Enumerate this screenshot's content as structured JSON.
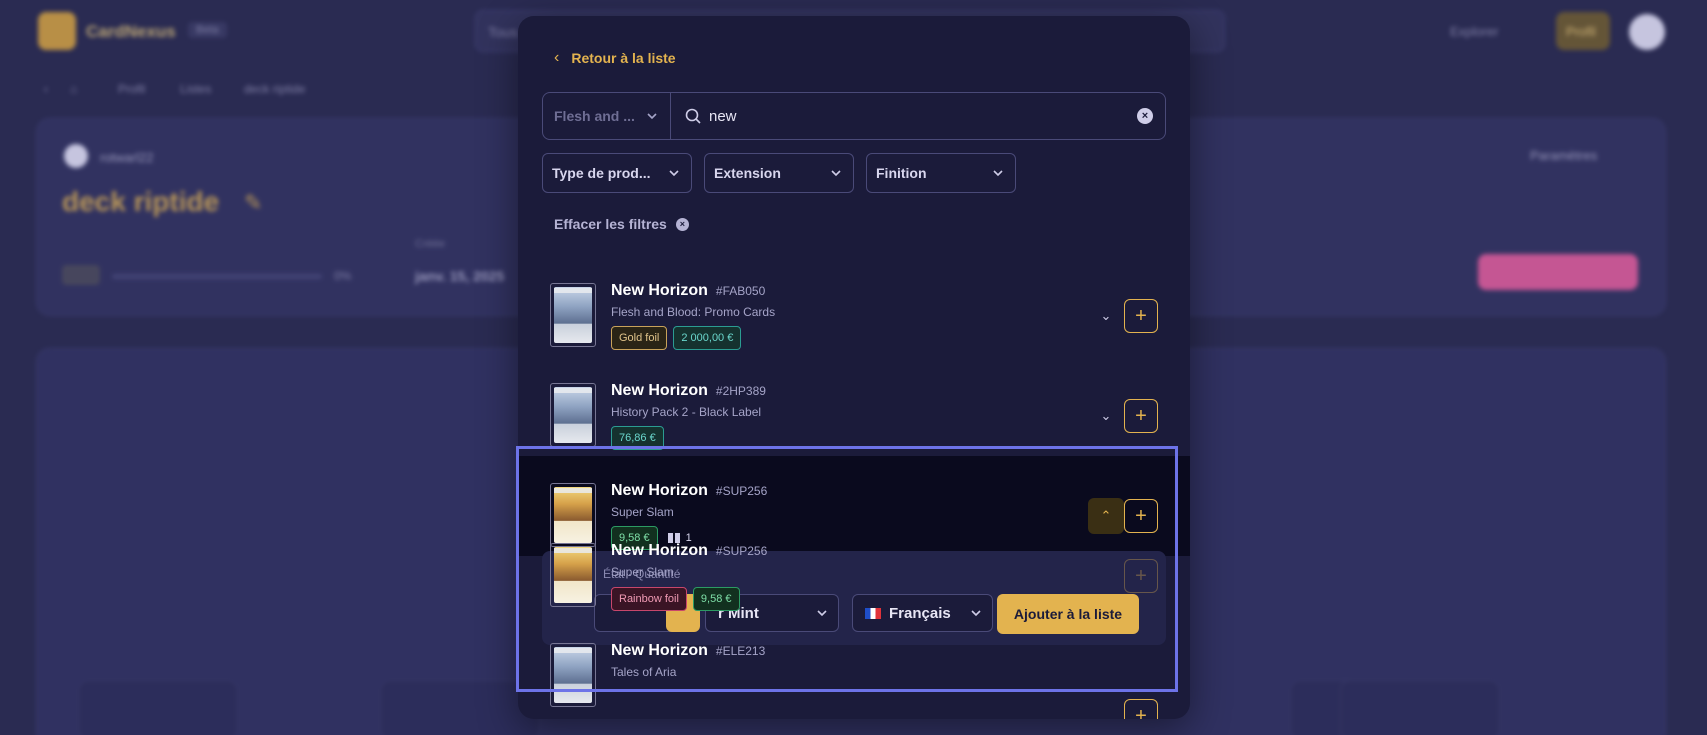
{
  "background": {
    "app_name": "CardNexus",
    "app_tag": "Beta",
    "search_placeholder": "Tous",
    "explorer_label": "Explorer",
    "profile_label": "Profil",
    "breadcrumb": [
      "Profil",
      "Listes",
      "deck riptide"
    ],
    "username": "rotwarl22",
    "deck_title": "deck riptide",
    "progress_pct": "0%",
    "date_label": "Créée",
    "date_value": "janv. 15, 2025",
    "settings_label": "Paramètres"
  },
  "modal": {
    "back_label": "Retour à la liste",
    "game_select": "Flesh and ...",
    "search_value": "new",
    "filters": [
      "Type de prod...",
      "Extension",
      "Finition"
    ],
    "clear_filters_label": "Effacer les filtres",
    "results": [
      {
        "name": "New Horizon",
        "code": "#FAB050",
        "set": "Flesh and Blood: Promo Cards",
        "finish": "Gold foil",
        "price": "2 000,00 €",
        "art": "blue"
      },
      {
        "name": "New Horizon",
        "code": "#2HP389",
        "set": "History Pack 2 - Black Label",
        "finish": "",
        "price": "76,86 €",
        "art": "blue"
      },
      {
        "name": "New Horizon",
        "code": "#SUP256",
        "set": "Super Slam",
        "finish": "",
        "price": "9,58 €",
        "stock": "1",
        "art": "gold",
        "expanded": true
      },
      {
        "name": "New Horizon",
        "code": "#SUP256",
        "set": "Super Slam",
        "finish": "Rainbow foil",
        "price": "9,58 €",
        "art": "gold"
      },
      {
        "name": "New Horizon",
        "code": "#ELE213",
        "set": "Tales of Aria",
        "art": "blue"
      }
    ],
    "add_panel": {
      "label": "État · Quantité",
      "condition": "Near Mint",
      "condition_visible": "r Mint",
      "language": "Français",
      "add_button": "Ajouter à la liste"
    }
  },
  "colors": {
    "accent": "#e3b34f",
    "modal_bg": "#1b1b3a",
    "selection": "#6d73e8"
  }
}
